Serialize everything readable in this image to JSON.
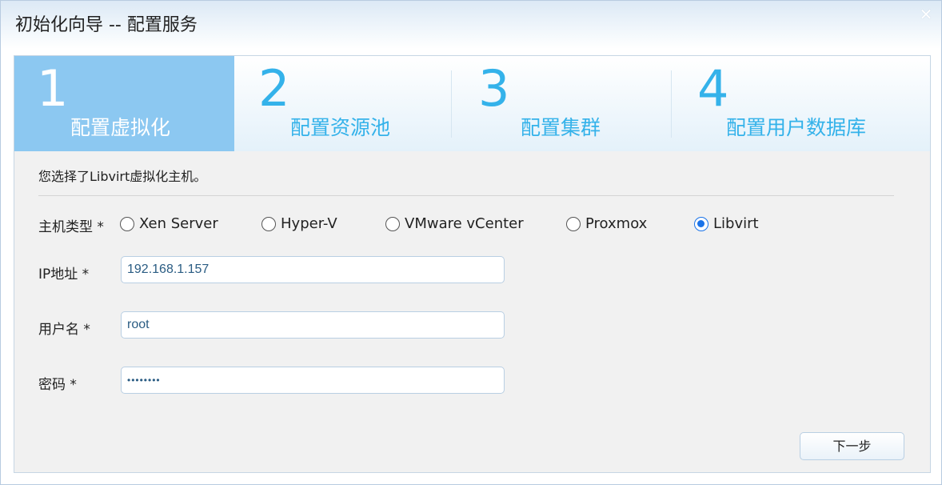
{
  "window": {
    "title": "初始化向导 -- 配置服务",
    "close_glyph": "✕"
  },
  "steps": [
    {
      "num": "1",
      "label": "配置虚拟化",
      "active": true
    },
    {
      "num": "2",
      "label": "配置资源池",
      "active": false
    },
    {
      "num": "3",
      "label": "配置集群",
      "active": false
    },
    {
      "num": "4",
      "label": "配置用户数据库",
      "active": false
    }
  ],
  "form": {
    "info_text": "您选择了Libvirt虚拟化主机。",
    "host_type": {
      "label": "主机类型 *",
      "options": [
        "Xen Server",
        "Hyper-V",
        "VMware vCenter",
        "Proxmox",
        "Libvirt"
      ],
      "selected": "Libvirt"
    },
    "ip": {
      "label": "IP地址 *",
      "value": "192.168.1.157"
    },
    "username": {
      "label": "用户名 *",
      "value": "root"
    },
    "password": {
      "label": "密码 *",
      "value": "••••••••"
    }
  },
  "buttons": {
    "next": "下一步"
  },
  "colors": {
    "accent": "#34b2ea",
    "active_step_bg": "#8cc8f1",
    "radio_checked": "#1a73e8"
  }
}
